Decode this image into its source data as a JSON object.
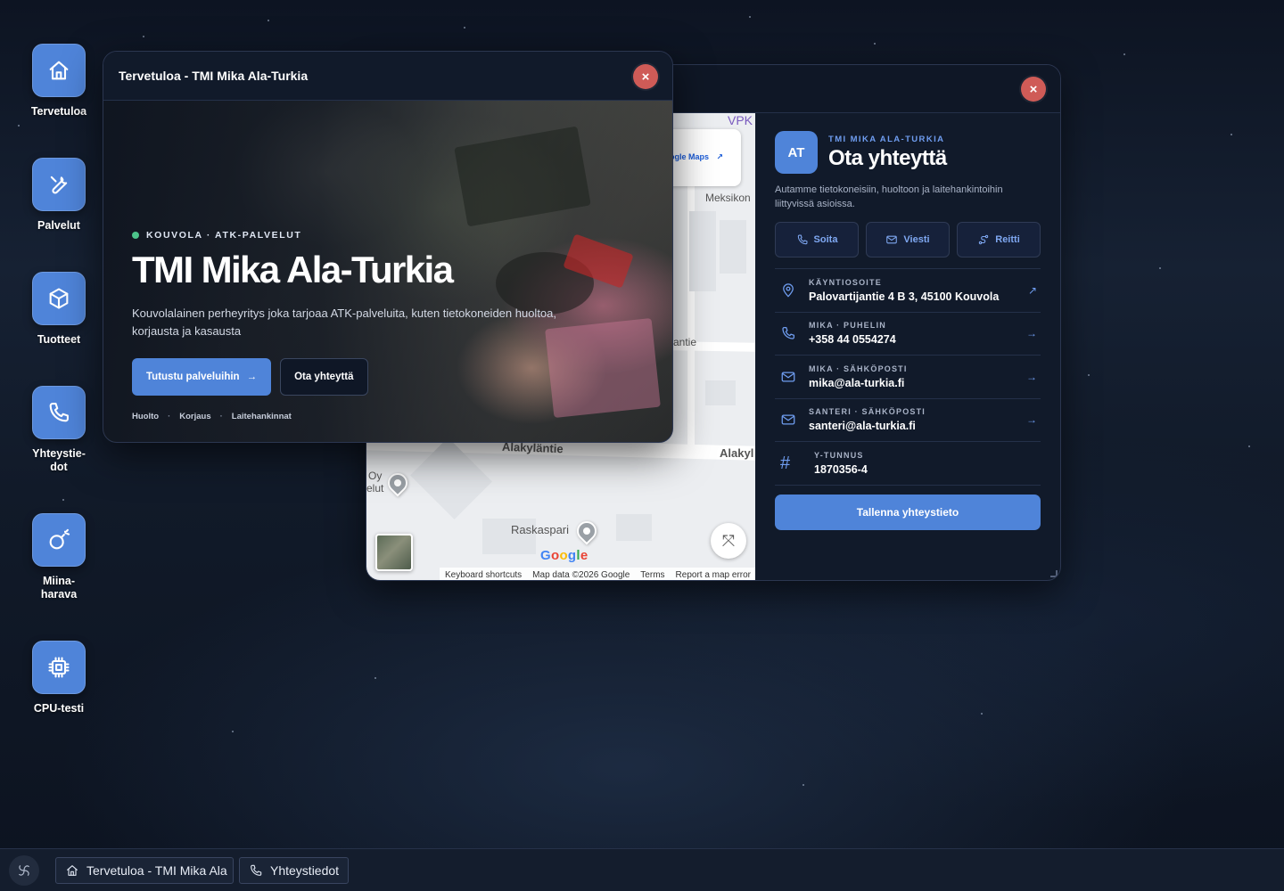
{
  "desktop": {
    "icons": [
      {
        "label": "Tervetuloa",
        "icon": "home-icon"
      },
      {
        "label": "Palvelut",
        "icon": "wrench-icon"
      },
      {
        "label": "Tuotteet",
        "icon": "box-icon"
      },
      {
        "label": "Yhteystie-\ndot",
        "icon": "phone-icon"
      },
      {
        "label": "Miina-\nharava",
        "icon": "bomb-icon"
      },
      {
        "label": "CPU-testi",
        "icon": "cpu-icon"
      }
    ]
  },
  "welcome": {
    "window_title": "Tervetuloa - TMI Mika Ala-Turkia",
    "close": "×",
    "pill": "KOUVOLA · ATK-PALVELUT",
    "heading": "TMI Mika Ala-Turkia",
    "lead": "Kouvolalainen perheyritys joka tarjoaa ATK-palveluita, kuten tietokoneiden huoltoa, korjausta ja kasausta",
    "primary_button": "Tutustu palveluihin",
    "primary_arrow": "→",
    "secondary_button": "Ota yhteyttä",
    "tags": [
      "Huolto",
      "Korjaus",
      "Laitehankinnat"
    ],
    "tag_sep": "·"
  },
  "contact": {
    "close": "×",
    "map": {
      "link_label": "ogle Maps",
      "link_arrow": "↗",
      "poi_vpk": "VPK",
      "label_meksikon": "Meksikon",
      "label_antie": "antie",
      "street_alakylantie": "Alakyläntie",
      "street_alakyl": "Alakyl",
      "label_oy": "Oy",
      "label_elut": "elut",
      "poi_raskaspari": "Raskaspari",
      "google": "Google",
      "footer": [
        "Keyboard shortcuts",
        "Map data ©2026 Google",
        "Terms",
        "Report a map error"
      ],
      "ctrl": "⤧"
    },
    "avatar": "AT",
    "kicker": "TMI MIKA ALA-TURKIA",
    "heading": "Ota yhteyttä",
    "description": "Autamme tietokoneisiin, huoltoon ja laitehankintoihin liittyvissä asioissa.",
    "actions": [
      {
        "label": "Soita",
        "icon": "phone-icon"
      },
      {
        "label": "Viesti",
        "icon": "mail-icon"
      },
      {
        "label": "Reitti",
        "icon": "route-icon"
      }
    ],
    "rows": [
      {
        "key": "KÄYNTIOSOITE",
        "value": "Palovartijantie 4 B 3, 45100 Kouvola",
        "icon": "map-pin-icon",
        "arrow": "↗"
      },
      {
        "key": "MIKA · PUHELIN",
        "value": "+358 44 0554274",
        "icon": "phone-icon",
        "arrow": "→"
      },
      {
        "key": "MIKA · SÄHKÖPOSTI",
        "value": "mika@ala-turkia.fi",
        "icon": "mail-icon",
        "arrow": "→"
      },
      {
        "key": "SANTERI · SÄHKÖPOSTI",
        "value": "santeri@ala-turkia.fi",
        "icon": "mail-icon",
        "arrow": "→"
      },
      {
        "key": "Y-TUNNUS",
        "value": "1870356-4",
        "icon": "hash-icon",
        "arrow": ""
      }
    ],
    "hash_glyph": "#",
    "save_button": "Tallenna yhteystieto"
  },
  "taskbar": {
    "items": [
      {
        "label": "Tervetuloa - TMI Mika Ala",
        "icon": "home-icon"
      },
      {
        "label": "Yhteystiedot",
        "icon": "phone-icon"
      }
    ]
  },
  "colors": {
    "accent": "#4f84d9",
    "close": "#cf5b57",
    "status": "#4cc38a",
    "panel": "#111a2a"
  }
}
